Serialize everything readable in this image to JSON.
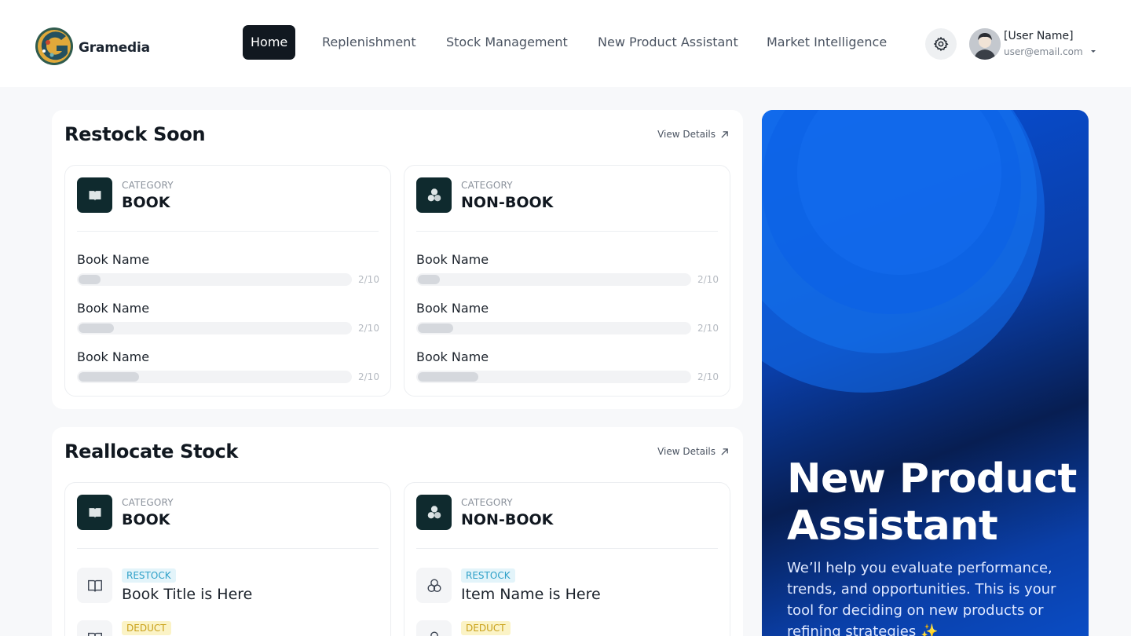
{
  "header": {
    "brand": "Gramedia",
    "nav": [
      {
        "label": "Home",
        "active": true
      },
      {
        "label": "Replenishment",
        "active": false
      },
      {
        "label": "Stock Management",
        "active": false
      },
      {
        "label": "New Product Assistant",
        "active": false
      },
      {
        "label": "Market Intelligence",
        "active": false
      }
    ],
    "user": {
      "name": "[User Name]",
      "email": "user@email.com"
    }
  },
  "restock": {
    "title": "Restock Soon",
    "view_details": "View Details",
    "cards": [
      {
        "category_label": "CATEGORY",
        "category": "BOOK",
        "icon": "book-icon",
        "items": [
          {
            "name": "Book Name",
            "count": "2/10",
            "fill": 0.08
          },
          {
            "name": "Book Name",
            "count": "2/10",
            "fill": 0.13
          },
          {
            "name": "Book Name",
            "count": "2/10",
            "fill": 0.22
          }
        ]
      },
      {
        "category_label": "CATEGORY",
        "category": "NON-BOOK",
        "icon": "shapes-icon",
        "items": [
          {
            "name": "Book Name",
            "count": "2/10",
            "fill": 0.08
          },
          {
            "name": "Book Name",
            "count": "2/10",
            "fill": 0.13
          },
          {
            "name": "Book Name",
            "count": "2/10",
            "fill": 0.22
          }
        ]
      }
    ]
  },
  "reallocate": {
    "title": "Reallocate Stock",
    "view_details": "View Details",
    "cards": [
      {
        "category_label": "CATEGORY",
        "category": "BOOK",
        "icon": "book-icon",
        "rows": [
          {
            "tag": "RESTOCK",
            "title": "Book Title is Here"
          },
          {
            "tag": "DEDUCT",
            "title": ""
          }
        ]
      },
      {
        "category_label": "CATEGORY",
        "category": "NON-BOOK",
        "icon": "shapes-icon",
        "rows": [
          {
            "tag": "RESTOCK",
            "title": "Item Name is Here"
          },
          {
            "tag": "DEDUCT",
            "title": ""
          }
        ]
      }
    ]
  },
  "promo": {
    "title": "New Product Assistant",
    "description": "We’ll help you evaluate performance, trends, and opportunities. This is your tool for deciding on new products or refining strategies ✨"
  },
  "colors": {
    "nav_active_bg": "#111820",
    "category_icon_bg": "#0f2a2e",
    "restock_tag": "#2ea0c8",
    "deduct_tag": "#c9a11a",
    "promo_blue": "#0750d8"
  }
}
